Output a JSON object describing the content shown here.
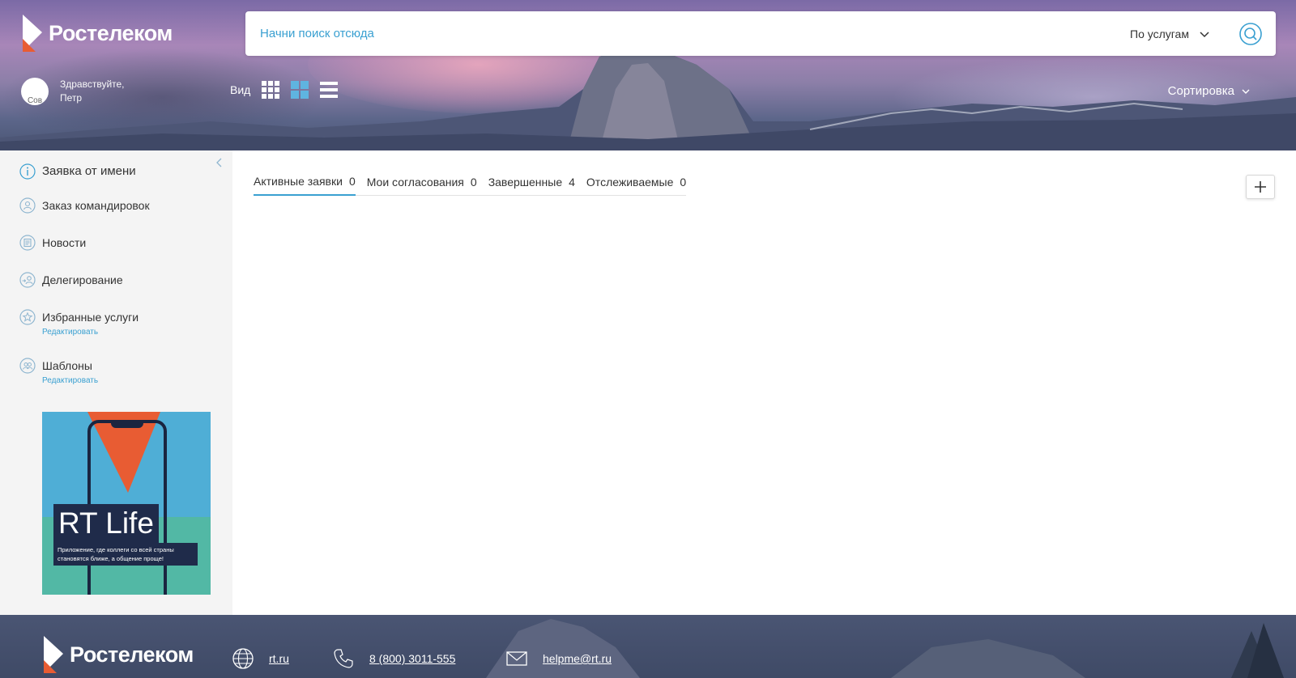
{
  "brand": {
    "name": "Ростелеком",
    "accent": "#3aa0d1",
    "orange": "#e85c33"
  },
  "search": {
    "placeholder": "Начни поиск отсюда",
    "scope": "По услугам"
  },
  "user": {
    "avatar_alt": "Сов",
    "greeting_line1": "Здравствуйте,",
    "greeting_line2": "Петр"
  },
  "view": {
    "label": "Вид",
    "modes": [
      "grid-small-icon",
      "grid-large-icon",
      "list-icon"
    ],
    "active_mode": "grid-large-icon"
  },
  "sort": {
    "label": "Сортировка"
  },
  "sidebar": {
    "items": [
      {
        "label": "Заявка от имени",
        "icon": "info-icon"
      },
      {
        "label": "Заказ командировок",
        "icon": "person-icon"
      },
      {
        "label": "Новости",
        "icon": "news-icon"
      },
      {
        "label": "Делегирование",
        "icon": "delegate-icon"
      },
      {
        "label": "Избранные услуги",
        "icon": "star-icon",
        "sub": "Редактировать"
      },
      {
        "label": "Шаблоны",
        "icon": "templates-icon",
        "sub": "Редактировать"
      }
    ],
    "banner": {
      "title": "RT Life",
      "text": "Приложение, где коллеги со всей страны становятся ближе, а общение проще!"
    }
  },
  "tabs": [
    {
      "label": "Активные заявки",
      "count": "0",
      "active": true
    },
    {
      "label": "Мои согласования",
      "count": "0",
      "active": false
    },
    {
      "label": "Завершенные",
      "count": "4",
      "active": false
    },
    {
      "label": "Отслеживаемые",
      "count": "0",
      "active": false
    }
  ],
  "footer": {
    "brand": "Ростелеком",
    "site": "rt.ru",
    "phone": "8 (800) 3011-555",
    "email": "helpme@rt.ru"
  }
}
